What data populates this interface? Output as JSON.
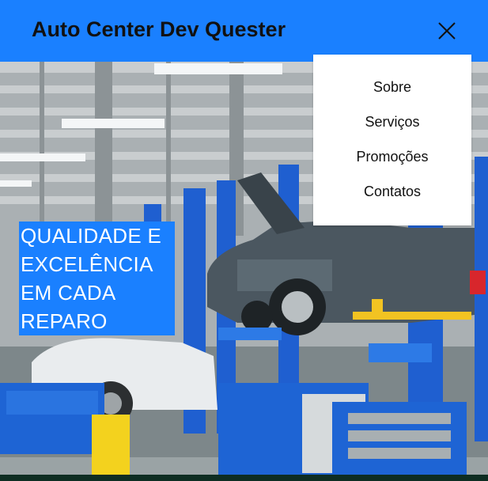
{
  "header": {
    "title": "Auto Center Dev Quester",
    "close_icon": "close-icon"
  },
  "menu": {
    "items": [
      {
        "label": "Sobre"
      },
      {
        "label": "Serviços"
      },
      {
        "label": "Promoções"
      },
      {
        "label": "Contatos"
      }
    ]
  },
  "hero": {
    "headline_lines": [
      "QUALIDADE E",
      "EXCELÊNCIA",
      "EM CADA",
      "REPARO"
    ]
  },
  "colors": {
    "accent": "#1a80ff",
    "menu_bg": "#ffffff",
    "text_dark": "#111111",
    "headline_text": "#ffffff"
  }
}
